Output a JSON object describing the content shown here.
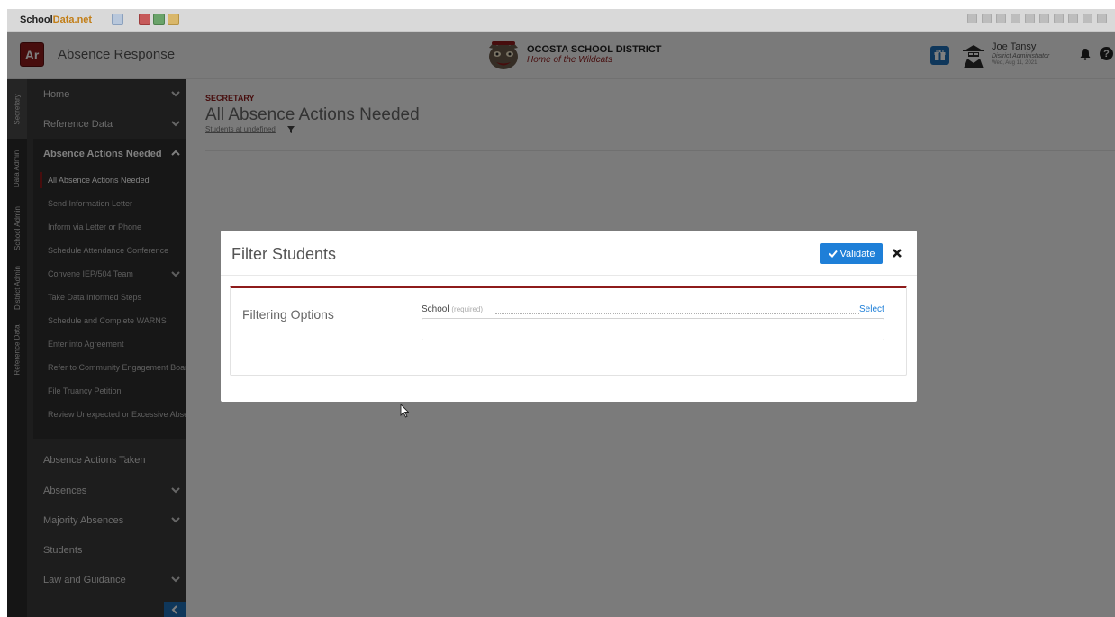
{
  "topbar": {
    "logo_main": "School",
    "logo_accent": "Data.net",
    "icon_names": [
      "module-icon",
      "module-icon",
      "module-icon",
      "module-icon",
      "module-icon",
      "module-icon"
    ],
    "right_icon_names": [
      "toolbar-icon",
      "toolbar-icon",
      "toolbar-icon",
      "toolbar-icon",
      "toolbar-icon",
      "toolbar-icon",
      "toolbar-icon",
      "toolbar-icon",
      "toolbar-icon",
      "toolbar-icon"
    ]
  },
  "header": {
    "app_badge": "Ar",
    "app_title": "Absence Response",
    "district_name": "OCOSTA SCHOOL DISTRICT",
    "district_tagline": "Home of the Wildcats",
    "user": {
      "name": "Joe Tansy",
      "role": "District Administrator",
      "date": "Wed, Aug 11, 2021"
    },
    "help_glyph": "?"
  },
  "role_rail": [
    {
      "label": "Secretary",
      "active": true
    },
    {
      "label": "Data Admin",
      "active": false
    },
    {
      "label": "School Admin",
      "active": false
    },
    {
      "label": "District Admin",
      "active": false
    },
    {
      "label": "Reference Data",
      "active": false
    }
  ],
  "sidebar": {
    "items": [
      {
        "label": "Home",
        "chevron": "down"
      },
      {
        "label": "Reference Data",
        "chevron": "down"
      },
      {
        "label": "Absence Actions Needed",
        "chevron": "up"
      },
      {
        "label": "Absence Actions Taken",
        "chevron": ""
      },
      {
        "label": "Absences",
        "chevron": "down"
      },
      {
        "label": "Majority Absences",
        "chevron": "down"
      },
      {
        "label": "Students",
        "chevron": ""
      },
      {
        "label": "Law and Guidance",
        "chevron": "down"
      }
    ],
    "subitems": [
      {
        "label": "All Absence Actions Needed",
        "active": true
      },
      {
        "label": "Send Information Letter"
      },
      {
        "label": "Inform via Letter or Phone"
      },
      {
        "label": "Schedule Attendance Conference"
      },
      {
        "label": "Convene IEP/504 Team",
        "chevron": "down"
      },
      {
        "label": "Take Data Informed Steps"
      },
      {
        "label": "Schedule and Complete WARNS"
      },
      {
        "label": "Enter into Agreement"
      },
      {
        "label": "Refer to Community Engagement Board"
      },
      {
        "label": "File Truancy Petition"
      },
      {
        "label": "Review Unexpected or Excessive Absences"
      }
    ]
  },
  "main": {
    "kicker": "SECRETARY",
    "title": "All Absence Actions Needed",
    "subtitle": "Students at undefined"
  },
  "modal": {
    "title": "Filter Students",
    "validate_label": "Validate",
    "panel_label": "Filtering Options",
    "field_label": "School",
    "field_required": "(required)",
    "select_label": "Select",
    "field_value": ""
  },
  "colors": {
    "accent_red": "#8e1b1b",
    "primary_blue": "#1e7fd8",
    "sidebar_bg": "#3a3a3a"
  }
}
